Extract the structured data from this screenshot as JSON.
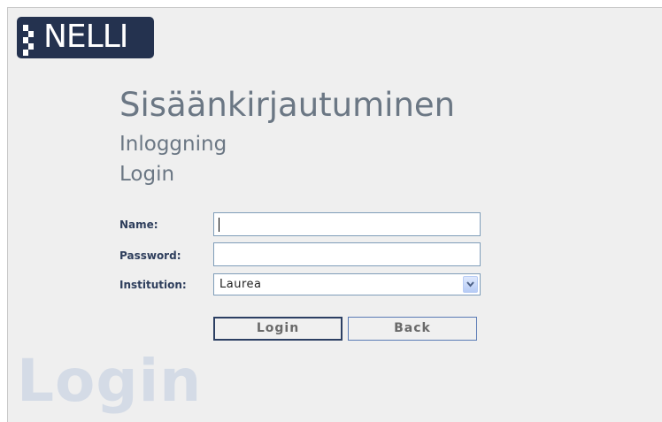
{
  "logo": {
    "text": "NELLI"
  },
  "titles": {
    "finnish": "Sisäänkirjautuminen",
    "swedish": "Inloggning",
    "english": "Login"
  },
  "form": {
    "name_label": "Name:",
    "name_value": "",
    "password_label": "Password:",
    "password_value": "",
    "institution_label": "Institution:",
    "institution_selected": "Laurea"
  },
  "buttons": {
    "login": "Login",
    "back": "Back"
  },
  "watermark": "Login",
  "colors": {
    "background": "#efefef",
    "logo_bg": "#24324f",
    "title": "#6b7784",
    "label": "#2e3e5c",
    "watermark": "#d4dbe6"
  }
}
